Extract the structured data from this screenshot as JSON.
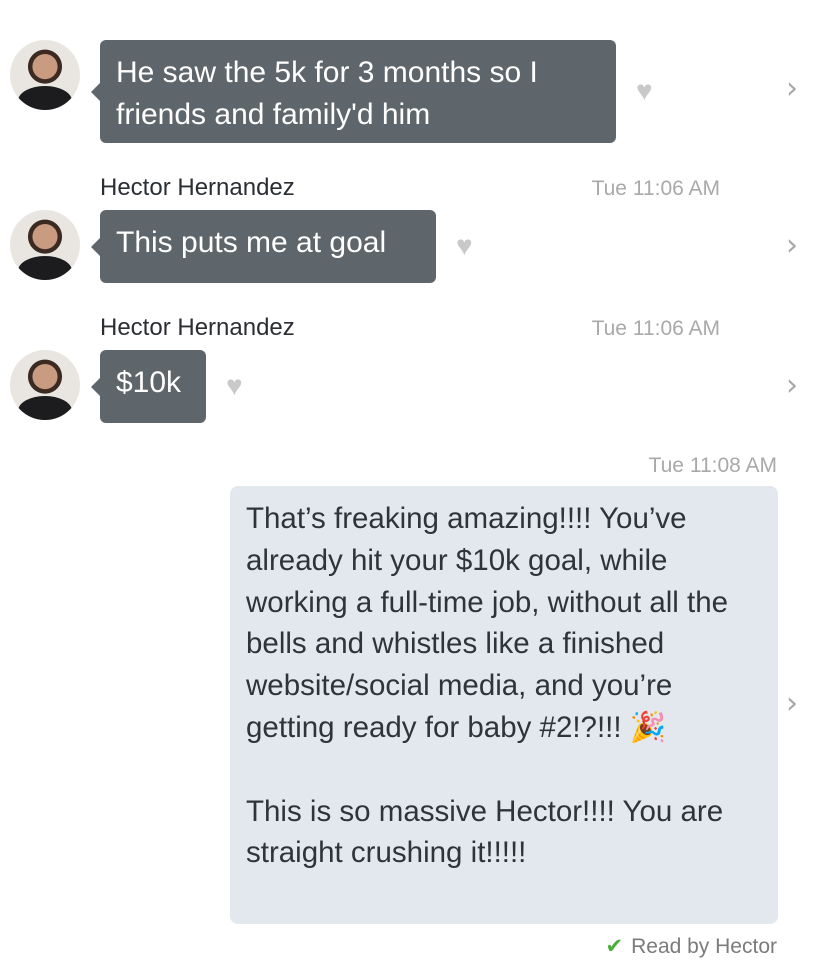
{
  "messages": [
    {
      "text": "He saw the 5k for 3 months so I friends and family'd him"
    },
    {
      "sender": "Hector Hernandez",
      "time": "Tue 11:06 AM",
      "text": "This puts me at goal"
    },
    {
      "sender": "Hector Hernandez",
      "time": "Tue 11:06 AM",
      "text": "$10k"
    }
  ],
  "outgoing": {
    "time": "Tue 11:08 AM",
    "paragraph1": "That’s freaking amazing!!!! You’ve already hit your $10k goal, while working a full-time job, without all the  bells and whistles like a finished website/social media, and you’re getting ready for baby #2!?!!!",
    "emoji": "🎉",
    "paragraph2": "This is so massive Hector!!!! You are straight crushing it!!!!!"
  },
  "read_receipt": {
    "check": "✔",
    "text": "Read by Hector"
  },
  "icons": {
    "heart": "♥",
    "chevron": "›"
  },
  "colors": {
    "incoming_bubble": "#5f666b",
    "outgoing_bubble": "#e3e8ee",
    "check": "#4cae3a"
  }
}
